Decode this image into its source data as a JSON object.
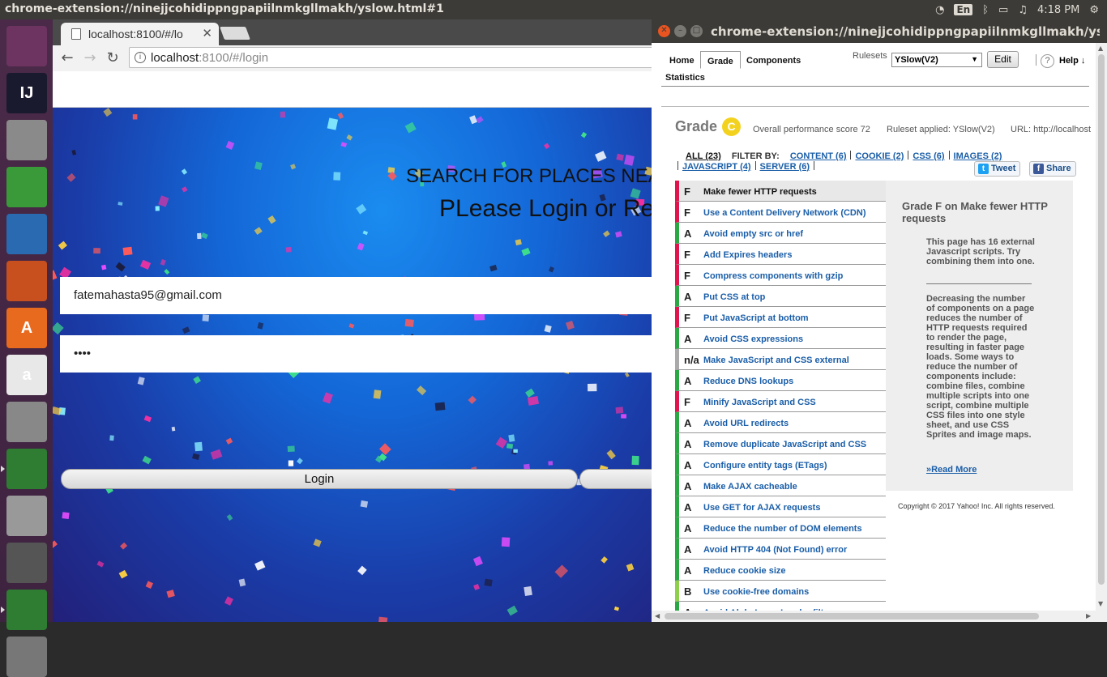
{
  "topbar": {
    "window_title": "chrome-extension://ninejjcohidippngpapiilnmkgllmakh/yslow.html#1",
    "lang": "En",
    "time": "4:18 PM"
  },
  "launcher": [
    {
      "name": "ubuntu-dash",
      "label": "",
      "color": "#6d3461"
    },
    {
      "name": "intellij",
      "label": "IJ",
      "color": "#1a1a2e"
    },
    {
      "name": "files",
      "label": "",
      "color": "#8a8a8a"
    },
    {
      "name": "calc",
      "label": "",
      "color": "#3a9a3a"
    },
    {
      "name": "writer",
      "label": "",
      "color": "#2a6ab0"
    },
    {
      "name": "impress",
      "label": "",
      "color": "#c8501e"
    },
    {
      "name": "software-center",
      "label": "A",
      "color": "#e86a1e"
    },
    {
      "name": "amazon",
      "label": "a",
      "color": "#e8e8e8"
    },
    {
      "name": "settings",
      "label": "",
      "color": "#888"
    },
    {
      "name": "chrome",
      "label": "",
      "color": "#2e7d32"
    },
    {
      "name": "disk",
      "label": "",
      "color": "#999"
    },
    {
      "name": "scanner",
      "label": "",
      "color": "#555"
    },
    {
      "name": "chrome-2",
      "label": "",
      "color": "#2e7d32"
    },
    {
      "name": "trash",
      "label": "",
      "color": "#777"
    }
  ],
  "browser": {
    "tab_title": "localhost:8100/#/lo",
    "url_host": "localhost",
    "url_path": ":8100/#/login",
    "heading1": "SEARCH FOR PLACES NEA",
    "heading2": "PLease Login or Re",
    "email_value": "fatemahasta95@gmail.com",
    "password_value": "••••",
    "login_label": "Login"
  },
  "yslow": {
    "window_title": "chrome-extension://ninejjcohidippngpapiilnmkgllmakh/yslow.html",
    "tabs": [
      "Home",
      "Grade",
      "Components",
      "Statistics"
    ],
    "rulesets_label": "Rulesets",
    "ruleset_selected": "YSlow(V2)",
    "edit_label": "Edit",
    "help_label": "Help ↓",
    "grade_title": "Grade",
    "grade_letter": "C",
    "overall_score": "Overall performance score 72",
    "ruleset_applied": "Ruleset applied: YSlow(V2)",
    "url_text": "URL: http://localhost",
    "filter_all": "ALL (23)",
    "filter_by": "FILTER BY:",
    "filters": [
      "CONTENT (6)",
      "COOKIE (2)",
      "CSS (6)",
      "IMAGES (2)",
      "JAVASCRIPT (4)",
      "SERVER (6)"
    ],
    "tweet_label": "Tweet",
    "share_label": "Share",
    "rules": [
      {
        "grade": "F",
        "name": "Make fewer HTTP requests"
      },
      {
        "grade": "F",
        "name": "Use a Content Delivery Network (CDN)"
      },
      {
        "grade": "A",
        "name": "Avoid empty src or href"
      },
      {
        "grade": "F",
        "name": "Add Expires headers"
      },
      {
        "grade": "F",
        "name": "Compress components with gzip"
      },
      {
        "grade": "A",
        "name": "Put CSS at top"
      },
      {
        "grade": "F",
        "name": "Put JavaScript at bottom"
      },
      {
        "grade": "A",
        "name": "Avoid CSS expressions"
      },
      {
        "grade": "n/a",
        "name": "Make JavaScript and CSS external"
      },
      {
        "grade": "A",
        "name": "Reduce DNS lookups"
      },
      {
        "grade": "F",
        "name": "Minify JavaScript and CSS"
      },
      {
        "grade": "A",
        "name": "Avoid URL redirects"
      },
      {
        "grade": "A",
        "name": "Remove duplicate JavaScript and CSS"
      },
      {
        "grade": "A",
        "name": "Configure entity tags (ETags)"
      },
      {
        "grade": "A",
        "name": "Make AJAX cacheable"
      },
      {
        "grade": "A",
        "name": "Use GET for AJAX requests"
      },
      {
        "grade": "A",
        "name": "Reduce the number of DOM elements"
      },
      {
        "grade": "A",
        "name": "Avoid HTTP 404 (Not Found) error"
      },
      {
        "grade": "A",
        "name": "Reduce cookie size"
      },
      {
        "grade": "B",
        "name": "Use cookie-free domains"
      },
      {
        "grade": "A",
        "name": "Avoid AlphaImageLoader filter"
      }
    ],
    "detail_title": "Grade F on Make fewer HTTP requests",
    "detail_summary": "This page has 16 external Javascript scripts. Try combining them into one.",
    "detail_body": "Decreasing the number of components on a page reduces the number of HTTP requests required to render the page, resulting in faster page loads. Some ways to reduce the number of components include: combine files, combine multiple scripts into one script, combine multiple CSS files into one style sheet, and use CSS Sprites and image maps.",
    "read_more": "»Read More",
    "copyright": "Copyright © 2017 Yahoo! Inc. All rights reserved."
  }
}
